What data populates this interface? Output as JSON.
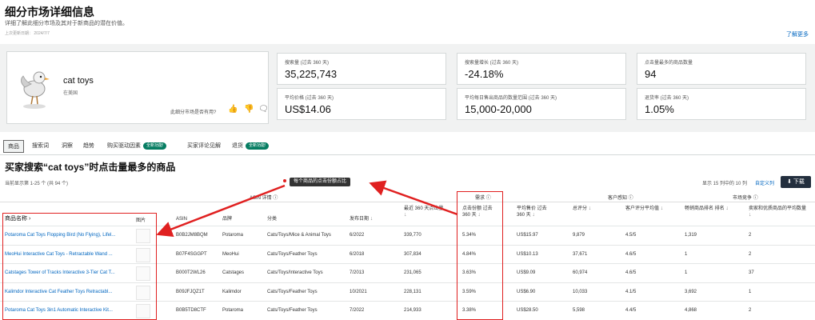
{
  "header": {
    "title": "细分市场详细信息",
    "subtitle": "详细了解此细分市场及其对于新商品的潜在价值。",
    "updated": "上次更新日期： 2024/7/7",
    "learn_more": "了解更多"
  },
  "product_card": {
    "name": "cat toys",
    "sub": "在美国",
    "helpful_question": "此细分市场是否有用?"
  },
  "metrics": [
    {
      "label": "搜索量 (过去 360 天)",
      "value": "35,225,743"
    },
    {
      "label": "搜索量增长 (过去 360 天)",
      "value": "-24.18%"
    },
    {
      "label": "点击量最多的商品数量",
      "value": "94"
    },
    {
      "label": "平均价格 (过去 360 天)",
      "value": "US$14.06"
    },
    {
      "label": "平均每日售出商品的数量范围 (过去 360 天)",
      "value": "15,000-20,000"
    },
    {
      "label": "退货率 (过去 360 天)",
      "value": "1.05%"
    }
  ],
  "tabs": [
    {
      "label": "商品"
    },
    {
      "label": "搜索词"
    },
    {
      "label": "洞察"
    },
    {
      "label": "趋势"
    },
    {
      "label": "购买驱动因素",
      "badge": "全新功能!"
    },
    {
      "label": "买家评论见解"
    },
    {
      "label": "退货",
      "badge": "全新功能!"
    }
  ],
  "section": {
    "title": "买家搜索“cat toys”时点击量最多的商品",
    "range": "当前显示第 1-25 个 (共 94 个)",
    "show": "显示 15 列中的 10 列",
    "edit_columns": "自定义列",
    "download": "下载",
    "tooltip": "每个商品的点击份额占比"
  },
  "table": {
    "groups": {
      "asin": "ASIN 详情",
      "demand": "需求",
      "customer": "客户感知",
      "competition": "市场竞争"
    },
    "headers": {
      "name": "商品名称",
      "image": "图片",
      "asin": "ASIN",
      "brand": "品牌",
      "category": "分类",
      "date": "发布日期",
      "clicks": "最近 360 天点击量",
      "share": "点击份额 过去 360 天",
      "price": "平均售价 过去 360 天",
      "reviews": "总评分",
      "rating": "客户评分平均值",
      "bsr": "畅销商品排名 排名",
      "sellers": "卖家和优质商品的平均数量"
    },
    "rows": [
      {
        "name": "Potaroma Cat Toys Flopping Bird (No Flying), Lifel...",
        "asin": "B0B2JM8BQM",
        "brand": "Potaroma",
        "category": "Cats/Toys/Mice & Animal Toys",
        "date": "6/2022",
        "clicks": "339,770",
        "share": "5.34%",
        "price": "US$15.97",
        "reviews": "9,879",
        "rating": "4.5/5",
        "bsr": "1,319",
        "sellers": "2"
      },
      {
        "name": "MeoHui Interactive Cat Toys - Retractable Wand ...",
        "asin": "B07F4SGGPT",
        "brand": "MeoHui",
        "category": "Cats/Toys/Feather Toys",
        "date": "6/2018",
        "clicks": "307,834",
        "share": "4.84%",
        "price": "US$10.13",
        "reviews": "37,671",
        "rating": "4.6/5",
        "bsr": "1",
        "sellers": "2"
      },
      {
        "name": "Catstages Tower of Tracks Interactive 3-Tier Cat T...",
        "asin": "B000T2WL26",
        "brand": "Catstages",
        "category": "Cats/Toys/Interactive Toys",
        "date": "7/2013",
        "clicks": "231,065",
        "share": "3.63%",
        "price": "US$9.09",
        "reviews": "60,974",
        "rating": "4.6/5",
        "bsr": "1",
        "sellers": "37"
      },
      {
        "name": "Kalimdor Interactive Cat Feather Toys Retractabl...",
        "asin": "B09JFJQZ1T",
        "brand": "Kalimdor",
        "category": "Cats/Toys/Feather Toys",
        "date": "10/2021",
        "clicks": "228,131",
        "share": "3.59%",
        "price": "US$6.90",
        "reviews": "10,033",
        "rating": "4.1/5",
        "bsr": "3,692",
        "sellers": "1"
      },
      {
        "name": "Potaroma Cat Toys 3in1 Automatic Interactive Kit...",
        "asin": "B0B5TD8CTF",
        "brand": "Potaroma",
        "category": "Cats/Toys/Feather Toys",
        "date": "7/2022",
        "clicks": "214,933",
        "share": "3.38%",
        "price": "US$28.50",
        "reviews": "5,598",
        "rating": "4.4/5",
        "bsr": "4,868",
        "sellers": "2"
      }
    ]
  }
}
